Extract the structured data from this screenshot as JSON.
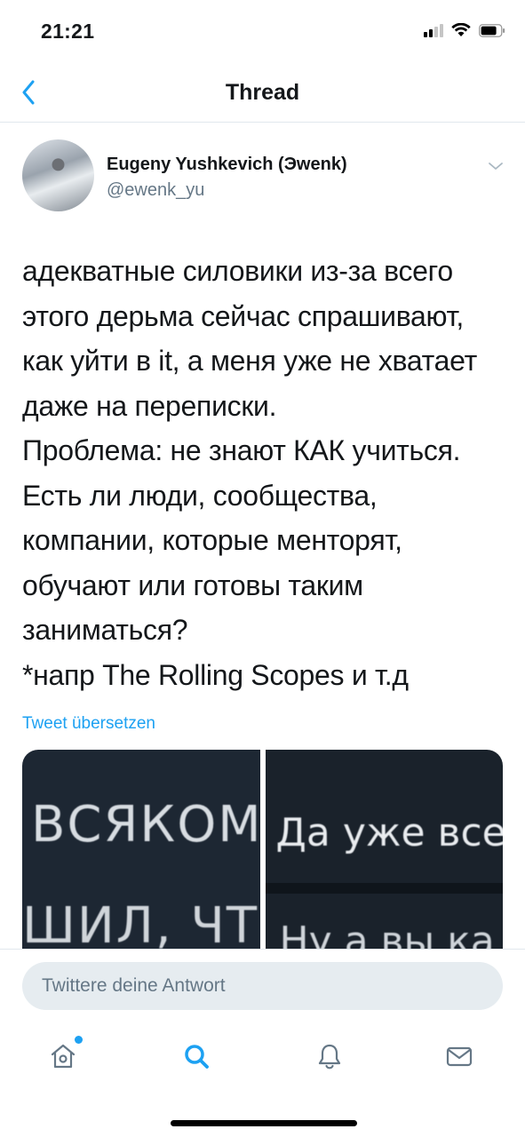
{
  "status_bar": {
    "time": "21:21"
  },
  "nav": {
    "title": "Thread"
  },
  "tweet": {
    "author_name": "Eugeny Yushkevich (Эwenk)",
    "author_handle": "@ewenk_yu",
    "text": "адекватные силовики из-за всего\nэтого дерьма сейчас спрашивают,\nкак уйти в it, а меня уже не хватает\nдаже на переписки.\nПроблема: не знают КАК учиться.\nЕсть ли люди, сообщества,\nкомпании, которые менторят,\nобучают или готовы таким\nзаниматься?\n*напр The Rolling Scopes и т.д",
    "translate_label": "Tweet übersetzen",
    "media": {
      "left_lines": [
        "ВСЯКОМ",
        "ШИЛ, ЧТ"
      ],
      "right_lines": [
        "Да уже все",
        "Ну а вы ка"
      ]
    }
  },
  "reply": {
    "placeholder": "Twittere deine Antwort"
  },
  "tab_bar": {
    "items": [
      {
        "icon": "home-icon",
        "has_badge": true
      },
      {
        "icon": "search-icon",
        "active": true
      },
      {
        "icon": "bell-icon"
      },
      {
        "icon": "mail-icon"
      }
    ]
  },
  "colors": {
    "accent": "#1da1f2",
    "text_primary": "#14171a",
    "text_secondary": "#657786",
    "divider": "#e1e8ed",
    "reply_field_bg": "#e6ecf0"
  }
}
